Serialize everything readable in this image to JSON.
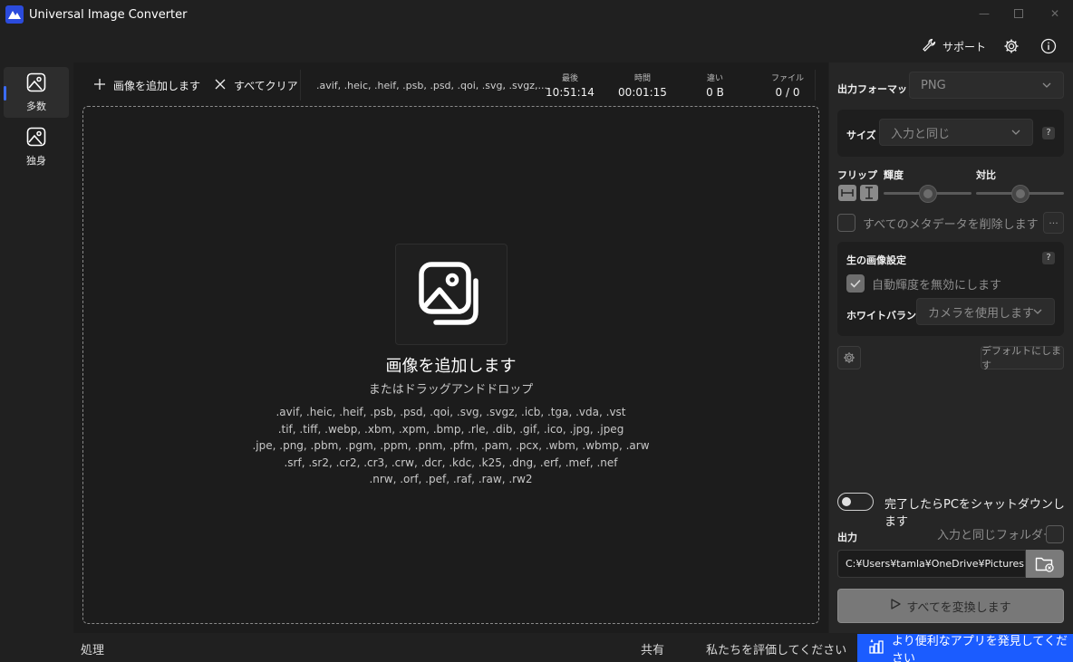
{
  "app": {
    "title": "Universal Image Converter"
  },
  "header": {
    "support_label": "サポート"
  },
  "sidebar": {
    "items": [
      {
        "label": "多数"
      },
      {
        "label": "独身"
      }
    ]
  },
  "toolbar": {
    "add_label": "画像を追加します",
    "clear_label": "すべてクリア",
    "formats_short": ".avif, .heic, .heif, .psb, .psd, .qoi, .svg, .svgz,...",
    "stats": [
      {
        "label": "最後",
        "value": "10:51:14"
      },
      {
        "label": "時間",
        "value": "00:01:15"
      },
      {
        "label": "違い",
        "value": "0 B"
      },
      {
        "label": "ファイル",
        "value": "0 / 0"
      }
    ]
  },
  "dropzone": {
    "title": "画像を追加します",
    "subtitle": "またはドラッグアンドドロップ",
    "format_lines": [
      ".avif, .heic, .heif, .psb, .psd, .qoi, .svg, .svgz, .icb, .tga, .vda, .vst",
      ".tif, .tiff, .webp, .xbm, .xpm, .bmp, .rle, .dib, .gif, .ico, .jpg, .jpeg",
      ".jpe, .png, .pbm, .pgm, .ppm, .pnm, .pfm, .pam, .pcx, .wbm, .wbmp, .arw",
      ".srf, .sr2, .cr2, .cr3, .crw, .dcr, .kdc, .k25, .dng, .erf, .mef, .nef",
      ".nrw, .orf, .pef, .raf, .raw, .rw2"
    ]
  },
  "settings": {
    "output_format_label": "出力フォーマット",
    "output_format_value": "PNG",
    "size_label": "サイズ",
    "size_value": "入力と同じ",
    "help": "?",
    "flip_label": "フリップ",
    "brightness_label": "輝度",
    "contrast_label": "対比",
    "brightness_level": 0.5,
    "contrast_level": 0.5,
    "remove_metadata_label": "すべてのメタデータを削除します",
    "more_label": "···",
    "raw_title": "生の画像設定",
    "disable_auto_brightness_label": "自動輝度を無効にします",
    "white_balance_label": "ホワイトバランス",
    "white_balance_value": "カメラを使用します",
    "default_button": "デフォルトにします",
    "shutdown_label": "完了したらPCをシャットダウンします",
    "output_label": "出力",
    "same_folder_label": "入力と同じフォルダー",
    "output_path": "C:¥Users¥tamla¥OneDrive¥Pictures",
    "convert_label": "すべてを変換します"
  },
  "statusbar": {
    "process_label": "処理",
    "share_label": "共有",
    "rate_label": "私たちを評価してください",
    "discover_label": "より便利なアプリを発見してください"
  },
  "colors": {
    "accent": "#1b5cff",
    "brand_logo": "#2b4bdc"
  }
}
